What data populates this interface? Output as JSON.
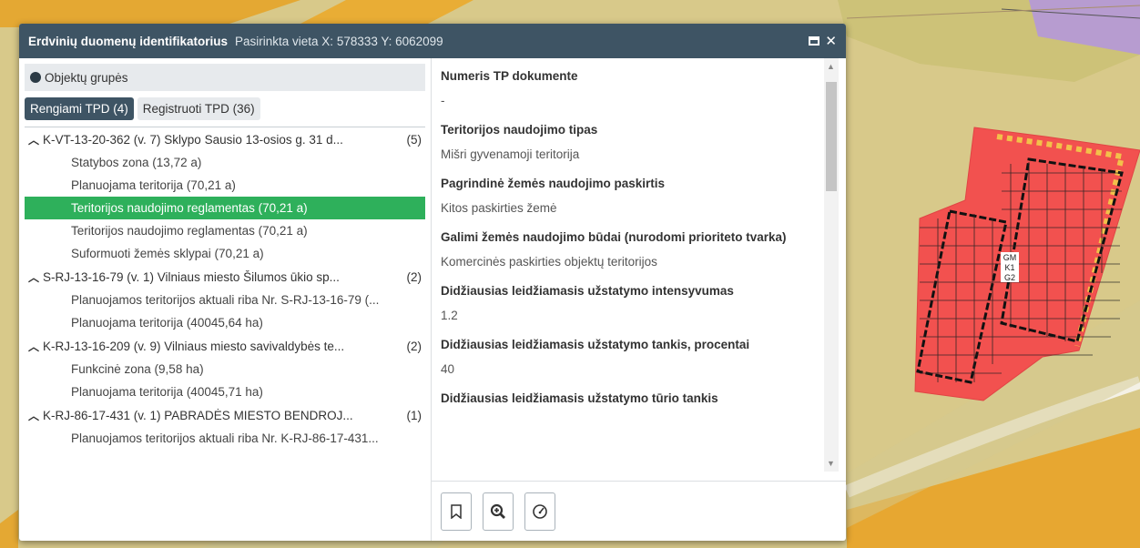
{
  "window": {
    "title": "Erdvinių duomenų identifikatorius",
    "subtitle": "Pasirinkta vieta X: 578333 Y: 6062099",
    "maximize_icon": "maximize-icon",
    "close_label": "✕"
  },
  "left": {
    "groups_label": "Objektų grupės",
    "tabs": [
      {
        "label": "Rengiami TPD (4)",
        "active": true
      },
      {
        "label": "Registruoti TPD (36)",
        "active": false
      }
    ],
    "groups": [
      {
        "label": "K-VT-13-20-362 (v. 7) Sklypo Sausio 13-osios g. 31 d...",
        "count": "(5)",
        "items": [
          "Statybos zona (13,72 a)",
          "Planuojama teritorija (70,21 a)",
          "Teritorijos naudojimo reglamentas (70,21 a)",
          "Teritorijos naudojimo reglamentas (70,21 a)",
          "Suformuoti žemės sklypai (70,21 a)"
        ]
      },
      {
        "label": "S-RJ-13-16-79 (v. 1) Vilniaus miesto Šilumos ūkio sp...",
        "count": "(2)",
        "items": [
          "Planuojamos teritorijos aktuali riba Nr. S-RJ-13-16-79 (...",
          "Planuojama teritorija (40045,64 ha)"
        ]
      },
      {
        "label": "K-RJ-13-16-209 (v. 9) Vilniaus miesto savivaldybės te...",
        "count": "(2)",
        "items": [
          "Funkcinė zona (9,58 ha)",
          "Planuojama teritorija (40045,71 ha)"
        ]
      },
      {
        "label": "K-RJ-86-17-431 (v. 1) PABRADĖS MIESTO BENDROJ...",
        "count": "(1)",
        "items": [
          "Planuojamos teritorijos aktuali riba Nr. K-RJ-86-17-431..."
        ]
      }
    ]
  },
  "details": {
    "fields": [
      {
        "label": "Numeris TP dokumente",
        "value": "-"
      },
      {
        "label": "Teritorijos naudojimo tipas",
        "value": "Mišri gyvenamoji teritorija"
      },
      {
        "label": "Pagrindinė žemės naudojimo paskirtis",
        "value": "Kitos paskirties žemė"
      },
      {
        "label": "Galimi žemės naudojimo būdai (nurodomi prioriteto tvarka)",
        "value": "Komercinės paskirties objektų teritorijos"
      },
      {
        "label": "Didžiausias leidžiamasis užstatymo intensyvumas",
        "value": "1.2"
      },
      {
        "label": "Didžiausias leidžiamasis užstatymo tankis, procentai",
        "value": "40"
      },
      {
        "label": "Didžiausias leidžiamasis užstatymo tūrio tankis",
        "value": ""
      }
    ]
  },
  "map_labels": [
    "GM",
    "K1",
    "G2"
  ]
}
